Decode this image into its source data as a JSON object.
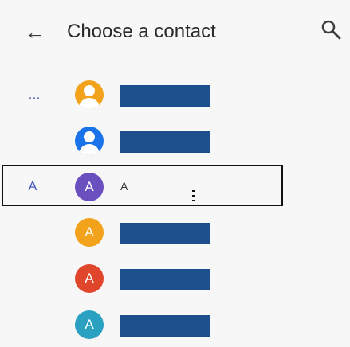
{
  "header": {
    "back_icon": "arrow-left-icon",
    "title": "Choose a contact",
    "search_icon": "search-icon"
  },
  "colors": {
    "accent": "#3f51b5",
    "name_placeholder": "#1d4f8c",
    "avatar_orange": "#f2a21b",
    "avatar_blue": "#1a73e8",
    "avatar_purple": "#6a4fbf",
    "avatar_red": "#e0462c",
    "avatar_teal": "#2aa1c0"
  },
  "contacts": [
    {
      "index": "…",
      "avatar_type": "person",
      "avatar_color": "#f2a21b",
      "name_hidden": true
    },
    {
      "index": "",
      "avatar_type": "person",
      "avatar_color": "#1a73e8",
      "name_hidden": true
    },
    {
      "index": "A",
      "avatar_type": "letter",
      "avatar_letter": "A",
      "avatar_color": "#6a4fbf",
      "name": "A",
      "name_hidden": false,
      "selected": true
    },
    {
      "index": "",
      "avatar_type": "letter",
      "avatar_letter": "A",
      "avatar_color": "#f2a21b",
      "name_hidden": true
    },
    {
      "index": "",
      "avatar_type": "letter",
      "avatar_letter": "A",
      "avatar_color": "#e0462c",
      "name_hidden": true
    },
    {
      "index": "",
      "avatar_type": "letter",
      "avatar_letter": "A",
      "avatar_color": "#2aa1c0",
      "name_hidden": true
    }
  ]
}
